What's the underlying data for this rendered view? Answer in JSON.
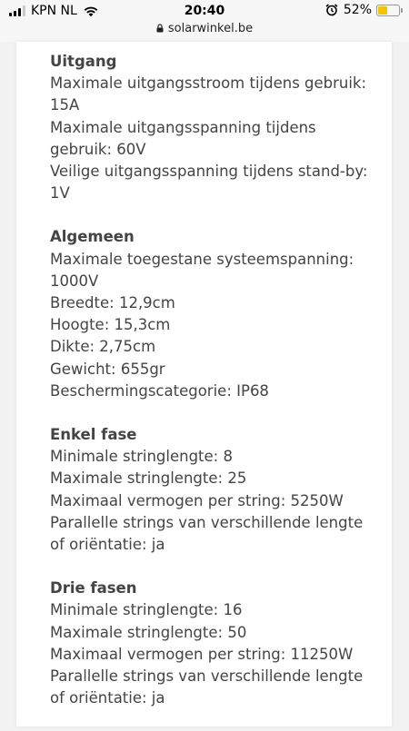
{
  "status_bar": {
    "carrier": "KPN NL",
    "time": "20:40",
    "battery_percent": "52%",
    "battery_level": 0.52,
    "battery_color": "#f5c400",
    "url": "solarwinkel.be"
  },
  "sections": [
    {
      "title": "Uitgang",
      "lines": [
        "Maximale uitgangsstroom tijdens gebruik: 15A",
        "Maximale uitgangsspanning tijdens gebruik: 60V",
        "Veilige uitgangsspanning tijdens stand-by: 1V"
      ]
    },
    {
      "title": "Algemeen",
      "lines": [
        "Maximale toegestane systeemspanning: 1000V",
        "Breedte: 12,9cm",
        "Hoogte: 15,3cm",
        "Dikte: 2,75cm",
        "Gewicht: 655gr",
        "Beschermingscategorie: IP68"
      ]
    },
    {
      "title": "Enkel fase",
      "lines": [
        "Minimale stringlengte: 8",
        "Maximale stringlengte: 25",
        "Maximaal vermogen per string: 5250W",
        "Parallelle strings van verschillende lengte of oriëntatie: ja"
      ]
    },
    {
      "title": "Drie fasen",
      "lines": [
        "Minimale stringlengte: 16",
        "Maximale stringlengte: 50",
        "Maximaal vermogen per string: 11250W",
        "Parallelle strings van verschillende lengte of oriëntatie: ja"
      ]
    }
  ]
}
